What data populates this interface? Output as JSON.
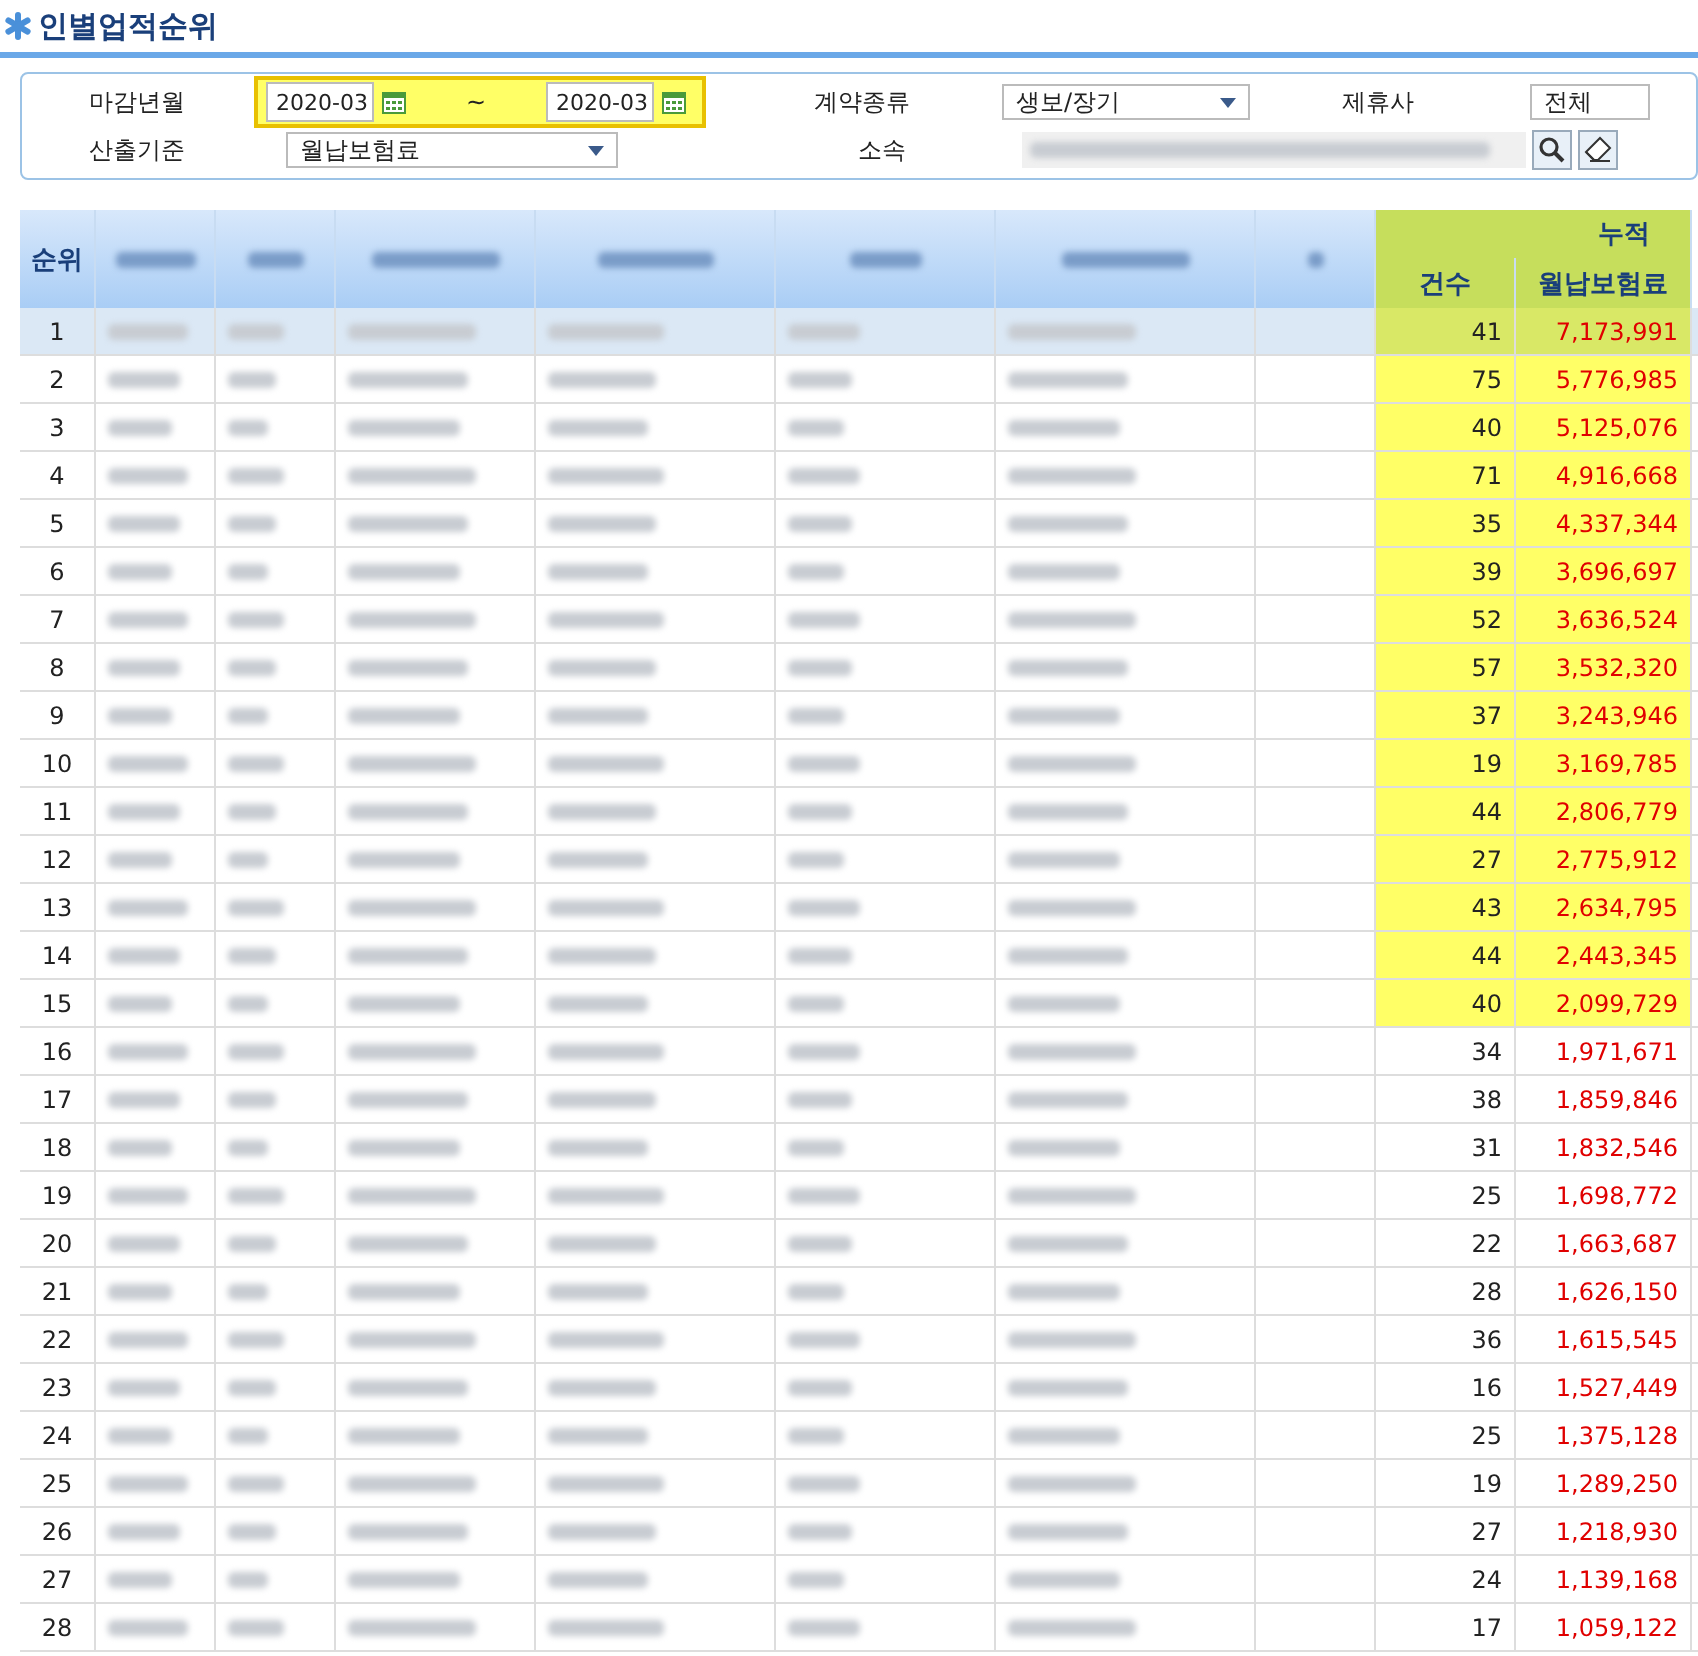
{
  "title": "인별업적순위",
  "filters": {
    "period": {
      "label": "마감년월",
      "from": "2020-03",
      "separator": "~",
      "to": "2020-03",
      "highlighted": true
    },
    "contract_type": {
      "label": "계약종류",
      "value": "생보/장기"
    },
    "partner": {
      "label": "제휴사",
      "value": "전체"
    },
    "basis": {
      "label": "산출기준",
      "value": "월납보험료"
    },
    "affiliation": {
      "label": "소속",
      "blurred": true
    }
  },
  "table": {
    "columns": [
      {
        "label": "순위",
        "blurred": false
      },
      {
        "blurred": true
      },
      {
        "blurred": true
      },
      {
        "blurred": true
      },
      {
        "blurred": true
      },
      {
        "blurred": true
      },
      {
        "blurred": true
      },
      {
        "blurred": true
      }
    ],
    "group": {
      "label": "누적",
      "highlighted": true,
      "columns": [
        "건수",
        "월납보험료"
      ]
    },
    "rows": [
      {
        "rank": "1",
        "count": "41",
        "premium": "7,173,991",
        "selected": true,
        "highlighted": true
      },
      {
        "rank": "2",
        "count": "75",
        "premium": "5,776,985",
        "selected": false,
        "highlighted": true
      },
      {
        "rank": "3",
        "count": "40",
        "premium": "5,125,076",
        "selected": false,
        "highlighted": true
      },
      {
        "rank": "4",
        "count": "71",
        "premium": "4,916,668",
        "selected": false,
        "highlighted": true
      },
      {
        "rank": "5",
        "count": "35",
        "premium": "4,337,344",
        "selected": false,
        "highlighted": true
      },
      {
        "rank": "6",
        "count": "39",
        "premium": "3,696,697",
        "selected": false,
        "highlighted": true
      },
      {
        "rank": "7",
        "count": "52",
        "premium": "3,636,524",
        "selected": false,
        "highlighted": true
      },
      {
        "rank": "8",
        "count": "57",
        "premium": "3,532,320",
        "selected": false,
        "highlighted": true
      },
      {
        "rank": "9",
        "count": "37",
        "premium": "3,243,946",
        "selected": false,
        "highlighted": true
      },
      {
        "rank": "10",
        "count": "19",
        "premium": "3,169,785",
        "selected": false,
        "highlighted": true
      },
      {
        "rank": "11",
        "count": "44",
        "premium": "2,806,779",
        "selected": false,
        "highlighted": true
      },
      {
        "rank": "12",
        "count": "27",
        "premium": "2,775,912",
        "selected": false,
        "highlighted": true
      },
      {
        "rank": "13",
        "count": "43",
        "premium": "2,634,795",
        "selected": false,
        "highlighted": true
      },
      {
        "rank": "14",
        "count": "44",
        "premium": "2,443,345",
        "selected": false,
        "highlighted": true
      },
      {
        "rank": "15",
        "count": "40",
        "premium": "2,099,729",
        "selected": false,
        "highlighted": true
      },
      {
        "rank": "16",
        "count": "34",
        "premium": "1,971,671",
        "selected": false,
        "highlighted": false
      },
      {
        "rank": "17",
        "count": "38",
        "premium": "1,859,846",
        "selected": false,
        "highlighted": false
      },
      {
        "rank": "18",
        "count": "31",
        "premium": "1,832,546",
        "selected": false,
        "highlighted": false
      },
      {
        "rank": "19",
        "count": "25",
        "premium": "1,698,772",
        "selected": false,
        "highlighted": false
      },
      {
        "rank": "20",
        "count": "22",
        "premium": "1,663,687",
        "selected": false,
        "highlighted": false
      },
      {
        "rank": "21",
        "count": "28",
        "premium": "1,626,150",
        "selected": false,
        "highlighted": false
      },
      {
        "rank": "22",
        "count": "36",
        "premium": "1,615,545",
        "selected": false,
        "highlighted": false
      },
      {
        "rank": "23",
        "count": "16",
        "premium": "1,527,449",
        "selected": false,
        "highlighted": false
      },
      {
        "rank": "24",
        "count": "25",
        "premium": "1,375,128",
        "selected": false,
        "highlighted": false
      },
      {
        "rank": "25",
        "count": "19",
        "premium": "1,289,250",
        "selected": false,
        "highlighted": false
      },
      {
        "rank": "26",
        "count": "27",
        "premium": "1,218,930",
        "selected": false,
        "highlighted": false
      },
      {
        "rank": "27",
        "count": "24",
        "premium": "1,139,168",
        "selected": false,
        "highlighted": false
      },
      {
        "rank": "28",
        "count": "17",
        "premium": "1,059,122",
        "selected": false,
        "highlighted": false
      }
    ]
  }
}
